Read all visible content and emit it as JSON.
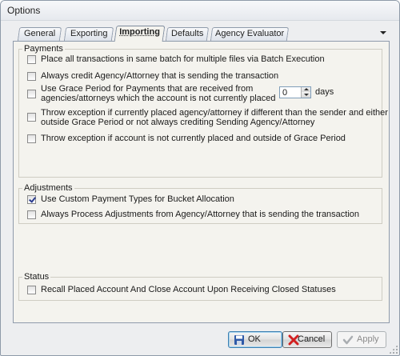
{
  "window": {
    "title": "Options"
  },
  "tabs": [
    {
      "label": "General"
    },
    {
      "label": "Exporting"
    },
    {
      "label": "Importing",
      "active": true
    },
    {
      "label": "Defaults"
    },
    {
      "label": "Agency Evaluator"
    }
  ],
  "payments": {
    "legend": "Payments",
    "options": [
      {
        "label": "Place all transactions in same batch for multiple files via Batch Execution",
        "checked": false
      },
      {
        "label": "Always credit Agency/Attorney that is sending the transaction",
        "checked": false
      },
      {
        "label_line1": "Use Grace Period for Payments that are received from",
        "label_line2": "agencies/attorneys which the account is not currently placed",
        "checked": false
      },
      {
        "label_line1": "Throw exception if currently placed agency/attorney if different than the sender and either",
        "label_line2": "outside Grace Period or not always crediting Sending Agency/Attorney",
        "checked": false
      },
      {
        "label": "Throw exception if account is not currently placed and outside of Grace Period",
        "checked": false
      }
    ],
    "grace_period": {
      "value": "0",
      "unit": "days"
    }
  },
  "adjustments": {
    "legend": "Adjustments",
    "options": [
      {
        "label": "Use Custom Payment Types for Bucket Allocation",
        "checked": true
      },
      {
        "label": "Always Process Adjustments from Agency/Attorney that is sending the transaction",
        "checked": false
      }
    ]
  },
  "status": {
    "legend": "Status",
    "options": [
      {
        "label": "Recall Placed Account And Close Account Upon Receiving Closed Statuses",
        "checked": false
      }
    ]
  },
  "buttons": {
    "ok": "OK",
    "cancel": "Cancel",
    "apply": "Apply"
  },
  "icons": {
    "ok": "save-icon",
    "cancel": "cancel-x-icon",
    "apply": "check-icon",
    "tab_menu": "chevron-down-icon"
  }
}
